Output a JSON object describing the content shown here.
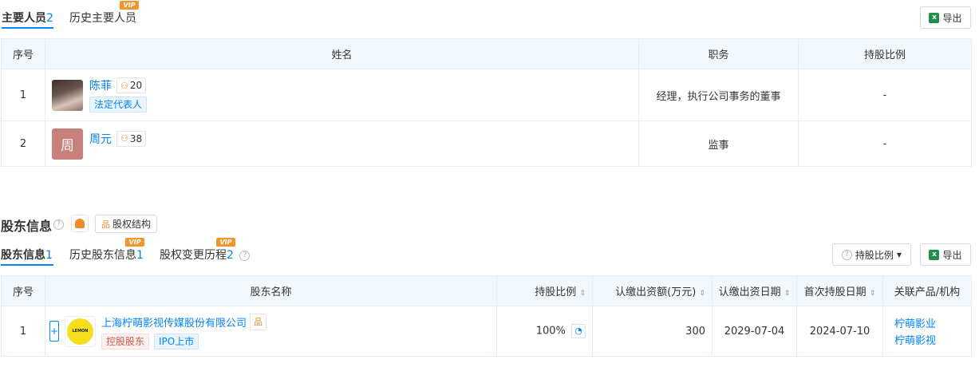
{
  "personnel": {
    "tab_main_label": "主要人员",
    "tab_main_count": "2",
    "tab_history_label": "历史主要人员",
    "vip_label": "VIP",
    "export_label": "导出",
    "headers": [
      "序号",
      "姓名",
      "职务",
      "持股比例"
    ],
    "rows": [
      {
        "index": "1",
        "name": "陈菲",
        "relation_count": "20",
        "tag": "法定代表人",
        "position": "经理，执行公司事务的董事",
        "share": "-"
      },
      {
        "index": "2",
        "name": "周元",
        "avatar_text": "周",
        "relation_count": "38",
        "position": "监事",
        "share": "-"
      }
    ]
  },
  "shareholders": {
    "section_title": "股东信息",
    "equity_structure_label": "股权结构",
    "tab_current_label": "股东信息",
    "tab_current_count": "1",
    "tab_history_label": "历史股东信息",
    "tab_history_count": "1",
    "tab_changes_label": "股权变更历程",
    "tab_changes_count": "2",
    "vip_label": "VIP",
    "sort_dropdown_label": "持股比例",
    "export_label": "导出",
    "headers": [
      "序号",
      "股东名称",
      "持股比例",
      "认缴出资额(万元)",
      "认缴出资日期",
      "首次持股日期",
      "关联产品/机构"
    ],
    "rows": [
      {
        "index": "1",
        "expand": "+",
        "logo_text": "LEMON",
        "name": "上海柠萌影视传媒股份有限公司",
        "tags": [
          "控股股东",
          "IPO上市"
        ],
        "share": "100%",
        "capital": "300",
        "capital_date": "2029-07-04",
        "first_date": "2024-07-10",
        "related": [
          "柠萌影业",
          "柠萌影视"
        ]
      }
    ]
  }
}
